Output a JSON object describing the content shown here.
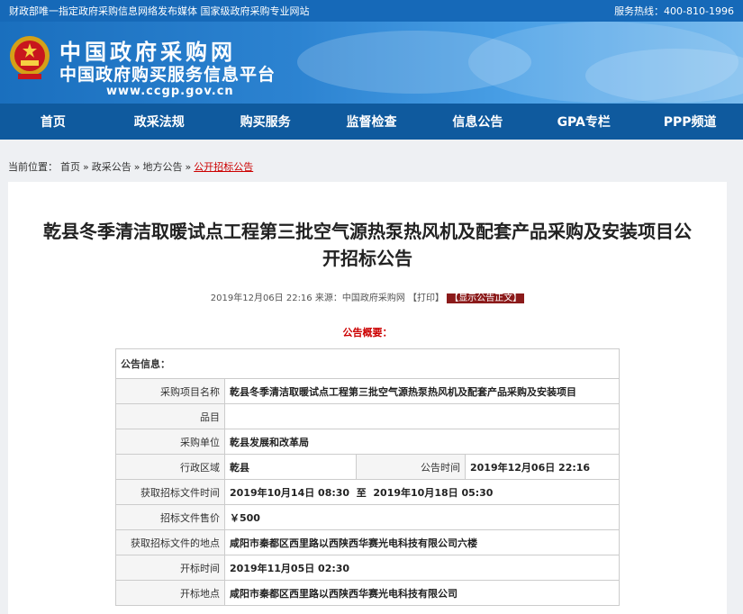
{
  "topbar": {
    "left_text": "财政部唯一指定政府采购信息网络发布媒体 国家级政府采购专业网站",
    "right_text": "服务热线：400-810-1996"
  },
  "banner": {
    "title": "中国政府采购网",
    "subtitle": "中国政府购买服务信息平台",
    "url": "www.ccgp.gov.cn"
  },
  "nav": {
    "items": [
      {
        "label": "首页"
      },
      {
        "label": "政采法规"
      },
      {
        "label": "购买服务"
      },
      {
        "label": "监督检查"
      },
      {
        "label": "信息公告"
      },
      {
        "label": "GPA专栏"
      },
      {
        "label": "PPP频道"
      }
    ]
  },
  "breadcrumb": {
    "prefix": "当前位置：",
    "items": [
      "首页",
      "政采公告",
      "地方公告",
      "公开招标公告"
    ],
    "sep": "»"
  },
  "article": {
    "title": "乾县冬季清洁取暖试点工程第三批空气源热泵热风机及配套产品采购及安装项目公开招标公告",
    "meta": "2019年12月06日 22:16 来源：中国政府采购网 【打印】",
    "show_text_button": "【显示公告正文】",
    "summary_label": "公告概要："
  },
  "table": {
    "section_header": "公告信息：",
    "rows": [
      {
        "label": "采购项目名称",
        "value": "乾县冬季清洁取暖试点工程第三批空气源热泵热风机及配套产品采购及安装项目"
      },
      {
        "label": "品目",
        "value": ""
      },
      {
        "label": "采购单位",
        "value": "乾县发展和改革局"
      },
      {
        "label": "行政区域",
        "value": "乾县",
        "label2": "公告时间",
        "value2": "2019年12月06日 22:16"
      },
      {
        "label": "获取招标文件时间",
        "value": "2019年10月14日 08:30  至  2019年10月18日 05:30"
      },
      {
        "label": "招标文件售价",
        "value": "￥500"
      },
      {
        "label": "获取招标文件的地点",
        "value": "咸阳市秦都区西里路以西陕西华赛光电科技有限公司六楼"
      },
      {
        "label": "开标时间",
        "value": "2019年11月05日 02:30"
      },
      {
        "label": "开标地点",
        "value": "咸阳市秦都区西里路以西陕西华赛光电科技有限公司"
      }
    ]
  }
}
